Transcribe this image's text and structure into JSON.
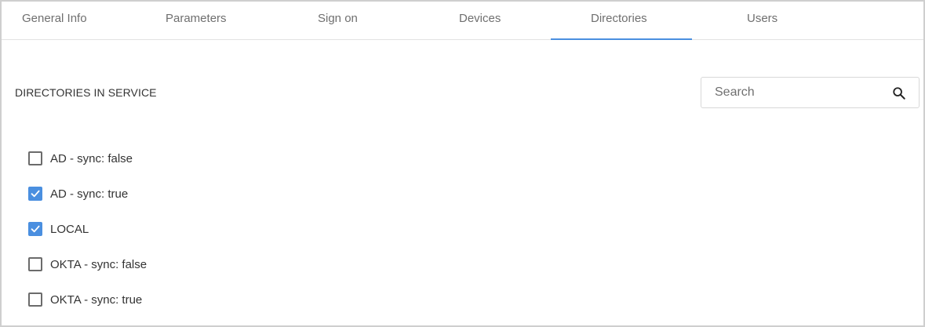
{
  "tabs": [
    {
      "label": "General Info",
      "active": false
    },
    {
      "label": "Parameters",
      "active": false
    },
    {
      "label": "Sign on",
      "active": false
    },
    {
      "label": "Devices",
      "active": false
    },
    {
      "label": "Directories",
      "active": true
    },
    {
      "label": "Users",
      "active": false
    }
  ],
  "section": {
    "title": "DIRECTORIES IN SERVICE"
  },
  "search": {
    "placeholder": "Search",
    "value": "",
    "icon": "search-icon"
  },
  "directories": [
    {
      "label": "AD - sync: false",
      "checked": false
    },
    {
      "label": "AD - sync: true",
      "checked": true
    },
    {
      "label": "LOCAL",
      "checked": true
    },
    {
      "label": "OKTA - sync: false",
      "checked": false
    },
    {
      "label": "OKTA - sync: true",
      "checked": false
    }
  ],
  "colors": {
    "accent": "#4a8fe0",
    "tab_text": "#6f6f6f",
    "text": "#333333",
    "border": "#cfcfcf"
  }
}
